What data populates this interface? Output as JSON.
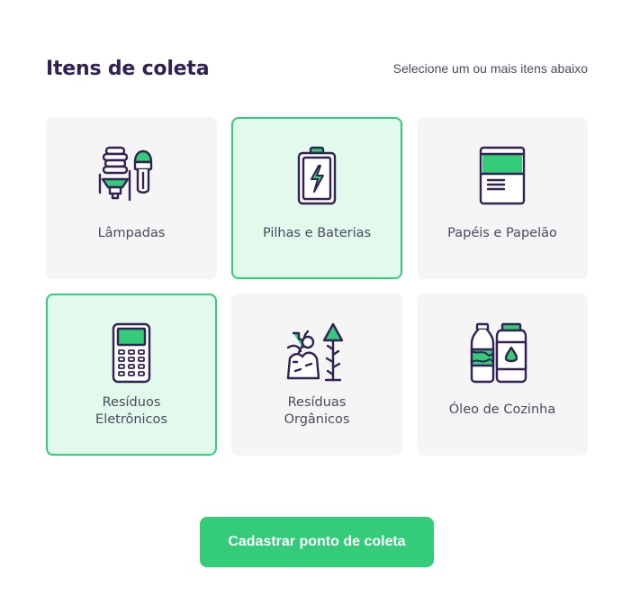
{
  "header": {
    "title": "Itens de coleta",
    "subtitle": "Selecione um ou mais itens abaixo"
  },
  "items": [
    {
      "label": "Lâmpadas",
      "icon": "lightbulbs-icon",
      "selected": false
    },
    {
      "label": "Pilhas e Baterias",
      "icon": "battery-icon",
      "selected": true
    },
    {
      "label": "Papéis e Papelão",
      "icon": "paper-icon",
      "selected": false
    },
    {
      "label": "Resíduos\nEletrônicos",
      "icon": "electronics-icon",
      "selected": true
    },
    {
      "label": "Resíduas\nOrgânicos",
      "icon": "organic-waste-icon",
      "selected": false
    },
    {
      "label": "Óleo de Cozinha",
      "icon": "cooking-oil-icon",
      "selected": false
    }
  ],
  "submit_button": {
    "label": "Cadastrar ponto de coleta"
  },
  "colors": {
    "accent": "#34cb79",
    "selected_bg": "#e1faec",
    "card_bg": "#f5f5f5",
    "text_dark": "#322153"
  }
}
